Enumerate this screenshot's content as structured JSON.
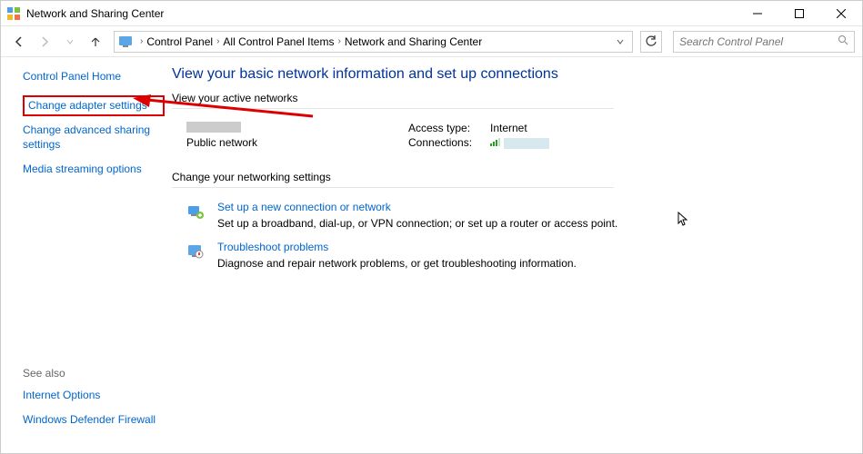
{
  "window": {
    "title": "Network and Sharing Center"
  },
  "breadcrumb": {
    "seg1": "Control Panel",
    "seg2": "All Control Panel Items",
    "seg3": "Network and Sharing Center"
  },
  "search": {
    "placeholder": "Search Control Panel"
  },
  "sidebar": {
    "home": "Control Panel Home",
    "adapter": "Change adapter settings",
    "advanced": "Change advanced sharing settings",
    "media": "Media streaming options",
    "see_also_hdr": "See also",
    "internet_opts": "Internet Options",
    "firewall": "Windows Defender Firewall"
  },
  "content": {
    "heading": "View your basic network information and set up connections",
    "active_hdr": "View your active networks",
    "net_type": "Public network",
    "access_label": "Access type:",
    "access_val": "Internet",
    "conn_label": "Connections:",
    "settings_hdr": "Change your networking settings",
    "setup_link": "Set up a new connection or network",
    "setup_desc": "Set up a broadband, dial-up, or VPN connection; or set up a router or access point.",
    "trouble_link": "Troubleshoot problems",
    "trouble_desc": "Diagnose and repair network problems, or get troubleshooting information."
  }
}
